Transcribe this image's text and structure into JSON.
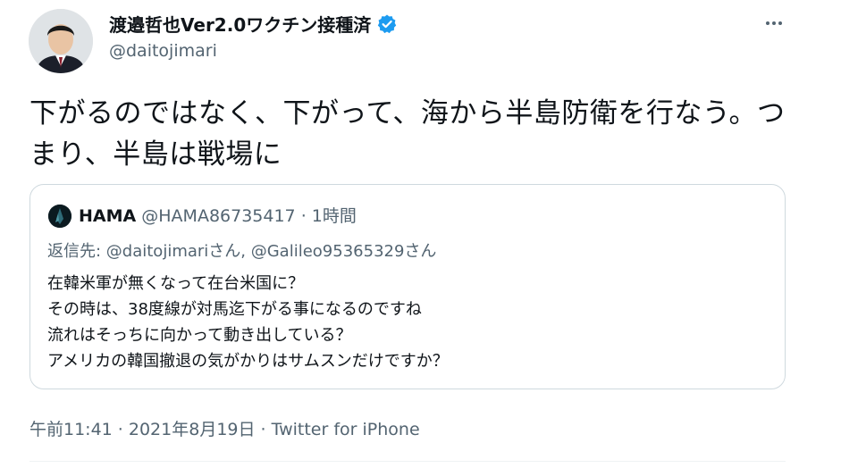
{
  "author": {
    "name": "渡邉哲也Ver2.0ワクチン接種済",
    "handle": "@daitojimari"
  },
  "tweet": {
    "text": "下がるのではなく、下がって、海から半島防衛を行なう。つまり、半島は戦場に"
  },
  "quoted": {
    "name": "HAMA",
    "handle": "@HAMA86735417",
    "separator": " · ",
    "time": "1時間",
    "reply_prefix": "返信先: ",
    "reply_to": "@daitojimariさん, @Galileo95365329さん",
    "body": "在韓米軍が無くなって在台米国に？\nその時は、38度線が対馬迄下がる事になるのですね\n流れはそっちに向かって動き出している？\nアメリカの韓国撤退の気がかりはサムスンだけですか？"
  },
  "footer": {
    "timestamp": "午前11:41 · 2021年8月19日 · Twitter for iPhone"
  },
  "colors": {
    "verified": "#1d9bf0",
    "secondary_text": "#536471",
    "border": "#cfd9de"
  },
  "icons": {
    "verified": "verified-badge-icon",
    "more": "more-options-icon"
  }
}
